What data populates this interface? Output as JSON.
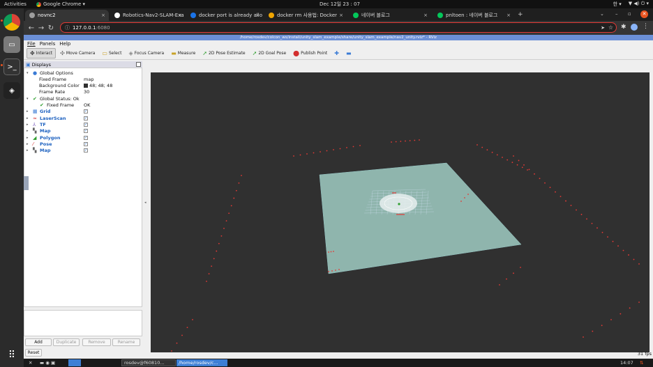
{
  "topbar": {
    "activities": "Activities",
    "app_name": "Google Chrome ▾",
    "clock": "Dec 12일  23 : 07",
    "tray": [
      "한 ▾",
      "▼ ◀) ⏻ ▾"
    ]
  },
  "chrome": {
    "tabs": [
      {
        "title": "novnc2",
        "close": "×",
        "color": "#9e9e9e"
      },
      {
        "title": "Robotics-Nav2-SLAM-Exa",
        "close": "×",
        "color": "#ffffff"
      },
      {
        "title": "docker port is already allo",
        "close": "×",
        "color": "#1a73e8"
      },
      {
        "title": "docker rm 사용법: Docker",
        "close": "×",
        "color": "#f0a500"
      },
      {
        "title": "네이버 블로그",
        "close": "×",
        "color": "#03c75a"
      },
      {
        "title": "pnltoen : 네이버 블로그",
        "close": "×",
        "color": "#03c75a"
      }
    ],
    "new_tab": "+",
    "url_host": "127.0.0.1",
    "url_port": ":6080",
    "window_controls": [
      "⌄",
      "–",
      "▫",
      "✕"
    ]
  },
  "rviz": {
    "title": "/home/rosdev/colcon_ws/install/unity_slam_example/share/unity_slam_example/nav2_unity.rviz* - RViz",
    "menu": [
      "File",
      "Panels",
      "Help"
    ],
    "tools": [
      {
        "label": "Interact",
        "icon": "✥",
        "active": true
      },
      {
        "label": "Move Camera",
        "icon": "✣",
        "active": false
      },
      {
        "label": "Select",
        "icon": "▭",
        "active": false
      },
      {
        "label": "Focus Camera",
        "icon": "◈",
        "active": false
      },
      {
        "label": "Measure",
        "icon": "▬",
        "active": false
      },
      {
        "label": "2D Pose Estimate",
        "icon": "➚",
        "active": false
      },
      {
        "label": "2D Goal Pose",
        "icon": "➚",
        "active": false
      },
      {
        "label": "Publish Point",
        "icon": "⬤",
        "active": false
      },
      {
        "label": "",
        "icon": "✚",
        "active": false
      },
      {
        "label": "",
        "icon": "▬",
        "active": false
      }
    ],
    "displays_header": "Displays",
    "tree": [
      {
        "label": "Global Options",
        "indent": 1,
        "arrow": "▾",
        "icon": "●",
        "icon_color": "#3a7bd5",
        "value": "",
        "check": false,
        "blue": false
      },
      {
        "label": "Fixed Frame",
        "indent": 2,
        "arrow": "",
        "icon": "",
        "icon_color": "",
        "value": "map",
        "check": false,
        "blue": false
      },
      {
        "label": "Background Color",
        "indent": 2,
        "arrow": "",
        "icon": "",
        "icon_color": "",
        "value": "48; 48; 48",
        "swatch": "#303030",
        "check": false,
        "blue": false
      },
      {
        "label": "Frame Rate",
        "indent": 2,
        "arrow": "",
        "icon": "",
        "icon_color": "",
        "value": "30",
        "check": false,
        "blue": false
      },
      {
        "label": "Global Status: Ok",
        "indent": 1,
        "arrow": "▾",
        "icon": "✔",
        "icon_color": "#2e9e2e",
        "value": "",
        "check": false,
        "blue": false
      },
      {
        "label": "Fixed Frame",
        "indent": 2,
        "arrow": "",
        "icon": "✔",
        "icon_color": "#2e9e2e",
        "value": "OK",
        "check": false,
        "blue": false
      },
      {
        "label": "Grid",
        "indent": 1,
        "arrow": "▸",
        "icon": "▦",
        "icon_color": "#3a7bd5",
        "value": "",
        "check": true,
        "blue": true
      },
      {
        "label": "LaserScan",
        "indent": 1,
        "arrow": "▸",
        "icon": "≈",
        "icon_color": "#d32f2f",
        "value": "",
        "check": true,
        "blue": true
      },
      {
        "label": "TF",
        "indent": 1,
        "arrow": "▸",
        "icon": "⅄",
        "icon_color": "#7a5cc0",
        "value": "",
        "check": true,
        "blue": true
      },
      {
        "label": "Map",
        "indent": 1,
        "arrow": "▸",
        "icon": "▚",
        "icon_color": "#666666",
        "value": "",
        "check": true,
        "blue": true
      },
      {
        "label": "Polygon",
        "indent": 1,
        "arrow": "▸",
        "icon": "◢",
        "icon_color": "#2e9e2e",
        "value": "",
        "check": true,
        "blue": true
      },
      {
        "label": "Pose",
        "indent": 1,
        "arrow": "▸",
        "icon": "⁄",
        "icon_color": "#d32f2f",
        "value": "",
        "check": true,
        "blue": true
      },
      {
        "label": "Map",
        "indent": 1,
        "arrow": "▸",
        "icon": "▚",
        "icon_color": "#666666",
        "value": "",
        "check": true,
        "blue": true
      }
    ],
    "buttons": {
      "add": "Add",
      "duplicate": "Duplicate",
      "remove": "Remove",
      "rename": "Rename"
    },
    "reset": "Reset",
    "fps": "31 fps"
  },
  "taskbar": {
    "items": [
      "rosdev@f60810...",
      "/home/rosdev/c..."
    ],
    "time": "14:07"
  },
  "colors": {
    "accent": "#e95420",
    "viewport_bg": "#303030",
    "map_floor": "#8fb5ad",
    "laser": "#e53935"
  }
}
